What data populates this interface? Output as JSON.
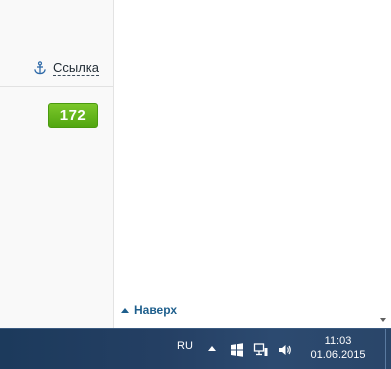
{
  "content": {
    "link_label": "Ссылка",
    "link_icon": "anchor-icon",
    "score": "172",
    "score_color": "#5cb31a",
    "to_top_label": "Наверх",
    "link_color": "#1e5f8d"
  },
  "taskbar": {
    "language": "RU",
    "time": "11:03",
    "date": "01.06.2015",
    "icons": [
      "show-hidden-icons-icon",
      "action-center-flag-icon",
      "network-icon",
      "volume-icon"
    ]
  }
}
